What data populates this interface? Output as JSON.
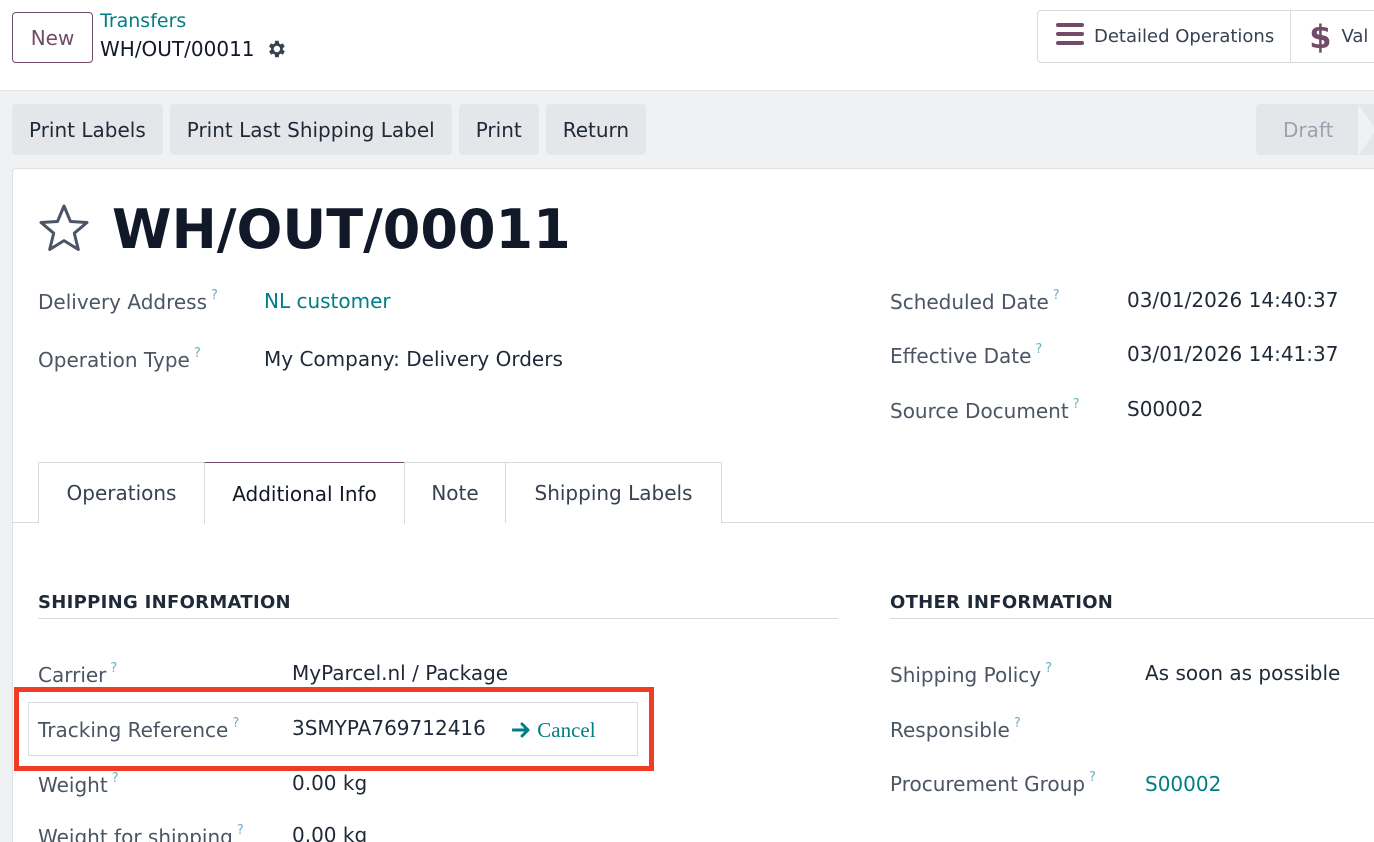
{
  "header": {
    "new_button": "New",
    "breadcrumb_parent": "Transfers",
    "breadcrumb_current": "WH/OUT/00011",
    "actions": [
      {
        "label": "Detailed Operations",
        "icon": "list-icon"
      },
      {
        "label": "Val",
        "icon": "dollar-icon"
      }
    ]
  },
  "action_buttons": [
    "Print Labels",
    "Print Last Shipping Label",
    "Print",
    "Return"
  ],
  "status": "Draft",
  "record": {
    "title": "WH/OUT/00011",
    "delivery_address_label": "Delivery Address",
    "delivery_address": "NL customer",
    "operation_type_label": "Operation Type",
    "operation_type": "My Company: Delivery Orders",
    "scheduled_date_label": "Scheduled Date",
    "scheduled_date": "03/01/2026 14:40:37",
    "effective_date_label": "Effective Date",
    "effective_date": "03/01/2026 14:41:37",
    "source_document_label": "Source Document",
    "source_document": "S00002"
  },
  "tabs": [
    "Operations",
    "Additional Info",
    "Note",
    "Shipping Labels"
  ],
  "active_tab": "Additional Info",
  "shipping": {
    "title": "SHIPPING INFORMATION",
    "carrier_label": "Carrier",
    "carrier": "MyParcel.nl / Package",
    "tracking_label": "Tracking Reference",
    "tracking": "3SMYPA769712416",
    "cancel_label": "Cancel",
    "weight_label": "Weight",
    "weight": "0.00",
    "weight_unit": "kg",
    "weight_shipping_label": "Weight for shipping",
    "weight_shipping": "0.00",
    "weight_shipping_unit": "kg"
  },
  "other": {
    "title": "OTHER INFORMATION",
    "shipping_policy_label": "Shipping Policy",
    "shipping_policy": "As soon as possible",
    "responsible_label": "Responsible",
    "procurement_group_label": "Procurement Group",
    "procurement_group": "S00002"
  },
  "help_marker": "?",
  "colors": {
    "brand": "#714b67",
    "link": "#017e84",
    "highlight": "#ee3d24"
  }
}
